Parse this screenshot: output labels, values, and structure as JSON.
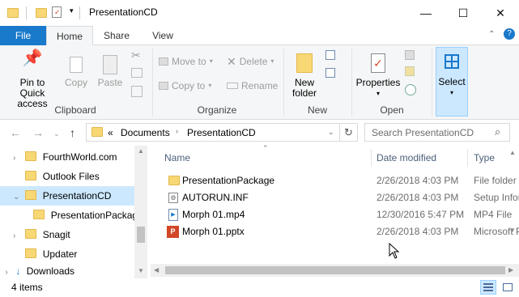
{
  "window": {
    "title": "PresentationCD"
  },
  "tabs": [
    "File",
    "Home",
    "Share",
    "View"
  ],
  "ribbon": {
    "clipboard": {
      "pin": "Pin to Quick access",
      "copy": "Copy",
      "paste": "Paste",
      "label": "Clipboard"
    },
    "organize": {
      "move_to": "Move to",
      "copy_to": "Copy to",
      "delete": "Delete",
      "rename": "Rename",
      "label": "Organize"
    },
    "new": {
      "new_folder": "New folder",
      "label": "New"
    },
    "open": {
      "properties": "Properties",
      "label": "Open"
    },
    "select": {
      "select": "Select"
    }
  },
  "address": {
    "overflow": "«",
    "crumbs": [
      "Documents",
      "PresentationCD"
    ]
  },
  "search": {
    "placeholder": "Search PresentationCD"
  },
  "tree": [
    {
      "label": "FourthWorld.com",
      "expander": "›"
    },
    {
      "label": "Outlook Files",
      "expander": ""
    },
    {
      "label": "PresentationCD",
      "expander": "⌄"
    },
    {
      "label": "PresentationPackage",
      "expander": ""
    },
    {
      "label": "Snagit",
      "expander": "›"
    },
    {
      "label": "Updater",
      "expander": ""
    },
    {
      "label": "Downloads",
      "expander": "›"
    }
  ],
  "columns": {
    "name": "Name",
    "date": "Date modified",
    "type": "Type"
  },
  "files": [
    {
      "name": "PresentationPackage",
      "date": "2/26/2018 4:03 PM",
      "type": "File folder",
      "icon": "folder-icon"
    },
    {
      "name": "AUTORUN.INF",
      "date": "2/26/2018 4:03 PM",
      "type": "Setup Information",
      "icon": "ini-file-icon"
    },
    {
      "name": "Morph 01.mp4",
      "date": "12/30/2016 5:47 PM",
      "type": "MP4 File",
      "icon": "video-file-icon"
    },
    {
      "name": "Morph 01.pptx",
      "date": "2/26/2018 4:03 PM",
      "type": "Microsoft PowerPoint Presentation",
      "icon": "powerpoint-file-icon"
    }
  ],
  "status": {
    "count": "4 items"
  },
  "colors": {
    "accent": "#1979ca",
    "selection": "#cce8ff",
    "folder": "#f8d775"
  }
}
